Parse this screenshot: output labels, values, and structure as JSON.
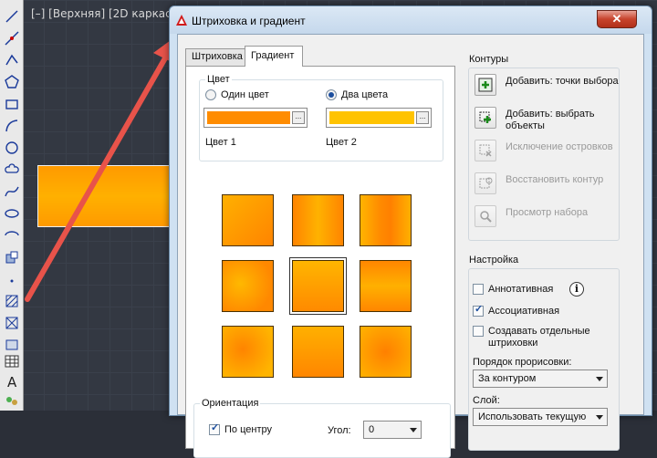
{
  "viewport": {
    "label": "[–] [Верхняя] [2D каркас]"
  },
  "dialog": {
    "title": "Штриховка и градиент",
    "close_label": "✕",
    "tabs": [
      {
        "label": "Штриховка",
        "active": false
      },
      {
        "label": "Градиент",
        "active": true
      }
    ],
    "color": {
      "group_title": "Цвет",
      "one_color_label": "Один цвет",
      "two_colors_label": "Два цвета",
      "selected_mode": "two",
      "color1_label": "Цвет 1",
      "color2_label": "Цвет 2",
      "color1_hex": "#ff8c00",
      "color2_hex": "#ffc300",
      "more_button": "..."
    },
    "orientation": {
      "group_title": "Ориентация",
      "centered_label": "По центру",
      "centered_checked": true,
      "angle_label": "Угол:",
      "angle_value": "0"
    },
    "contours": {
      "group_title": "Контуры",
      "actions": [
        {
          "label": "Добавить: точки выбора",
          "enabled": true,
          "icon": "add-pick-points-icon"
        },
        {
          "label": "Добавить: выбрать объекты",
          "enabled": true,
          "icon": "add-select-objects-icon"
        },
        {
          "label": "Исключение островков",
          "enabled": false,
          "icon": "remove-islands-icon"
        },
        {
          "label": "Восстановить контур",
          "enabled": false,
          "icon": "recreate-boundary-icon"
        },
        {
          "label": "Просмотр набора",
          "enabled": false,
          "icon": "view-selections-icon"
        }
      ]
    },
    "options": {
      "group_title": "Настройка",
      "annotative_label": "Аннотативная",
      "annotative_checked": false,
      "associative_label": "Ассоциативная",
      "associative_checked": true,
      "separate_label": "Создавать отдельные штриховки",
      "separate_checked": false,
      "draw_order_label": "Порядок прорисовки:",
      "draw_order_value": "За контуром",
      "layer_label": "Слой:",
      "layer_value": "Использовать текущую"
    }
  },
  "colors": {
    "accent_orange": "#ff9a00",
    "arrow_red": "#e8534a"
  }
}
